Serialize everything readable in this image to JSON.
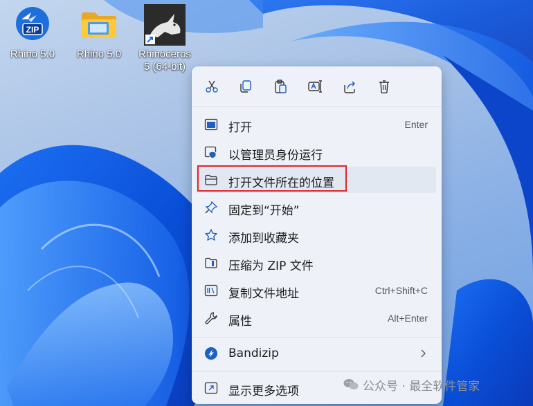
{
  "desktop": {
    "icons": [
      {
        "label": "Rhino 5.0",
        "icon": "zip-archive-icon",
        "badge": "ZIP"
      },
      {
        "label": "Rhino 5.0",
        "icon": "folder-icon"
      },
      {
        "label": "Rhinoceros",
        "label2": "5 (64-bit)",
        "icon": "rhinoceros-app-icon"
      }
    ]
  },
  "context_menu": {
    "toolbar": [
      {
        "name": "cut-icon"
      },
      {
        "name": "copy-icon"
      },
      {
        "name": "paste-icon"
      },
      {
        "name": "rename-icon"
      },
      {
        "name": "share-icon"
      },
      {
        "name": "delete-icon"
      }
    ],
    "items": [
      {
        "label": "打开",
        "shortcut": "Enter",
        "icon": "open-icon"
      },
      {
        "label": "以管理员身份运行",
        "shortcut": "",
        "icon": "run-as-admin-icon"
      },
      {
        "label": "打开文件所在的位置",
        "shortcut": "",
        "icon": "folder-outline-icon",
        "highlighted": true
      },
      {
        "label": "固定到“开始”",
        "shortcut": "",
        "icon": "pin-icon"
      },
      {
        "label": "添加到收藏夹",
        "shortcut": "",
        "icon": "star-icon"
      },
      {
        "label": "压缩为 ZIP 文件",
        "shortcut": "",
        "icon": "zip-folder-icon"
      },
      {
        "label": "复制文件地址",
        "shortcut": "Ctrl+Shift+C",
        "icon": "copy-path-icon"
      },
      {
        "label": "属性",
        "shortcut": "Alt+Enter",
        "icon": "wrench-icon"
      }
    ],
    "bandizip": {
      "label": "Bandizip",
      "icon": "bandizip-icon"
    },
    "more": {
      "label": "显示更多选项",
      "icon": "more-options-icon"
    }
  },
  "watermark": {
    "text": "公众号 · 最全软件管家"
  },
  "colors": {
    "accent": "#0067c0",
    "highlight_border": "#e0262b",
    "menu_bg": "#eef2f8"
  }
}
